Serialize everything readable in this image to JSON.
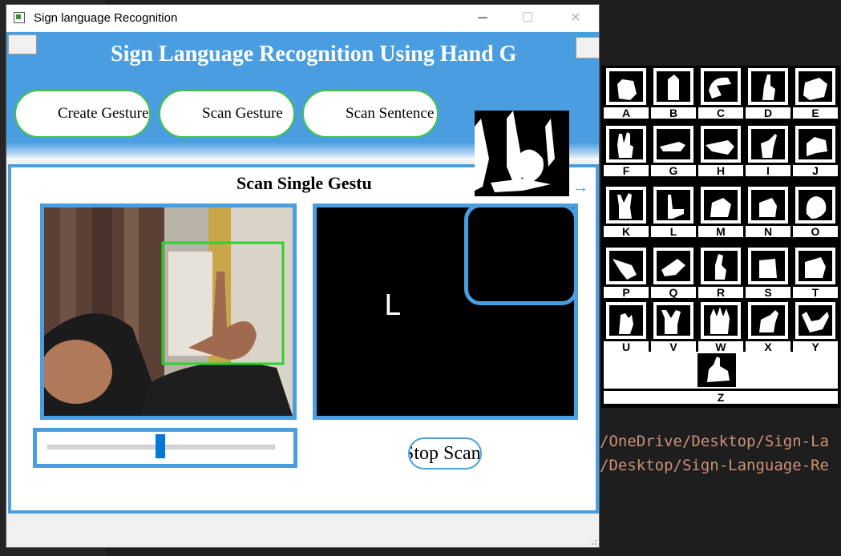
{
  "window": {
    "title": "Sign language Recognition",
    "controls": {
      "minimize": "─",
      "maximize": "☐",
      "close": "✕"
    }
  },
  "header": {
    "title": "Sign Language Recognition Using Hand G",
    "buttons": [
      {
        "label": "Create Gesture"
      },
      {
        "label": "Scan Gesture"
      },
      {
        "label": "Scan Sentence"
      }
    ]
  },
  "main": {
    "section_title": "Scan Single Gestu",
    "prediction": "L",
    "slider": {
      "value_fraction": 0.5
    },
    "stop_button": "Stop Scan"
  },
  "gesture_chart": {
    "letters": [
      "A",
      "B",
      "C",
      "D",
      "E",
      "F",
      "G",
      "H",
      "I",
      "J",
      "K",
      "L",
      "M",
      "N",
      "O",
      "P",
      "Q",
      "R",
      "S",
      "T",
      "U",
      "V",
      "W",
      "X",
      "Y"
    ],
    "last_letter": "Z"
  },
  "background": {
    "path_lines": [
      "/OneDrive/Desktop/Sign-La",
      "/Desktop/Sign-Language-Re"
    ]
  },
  "colors": {
    "accent": "#4a9ee0",
    "pill_border": "#3ec44d",
    "slider_thumb": "#0078d7",
    "box_green": "#2ad32a"
  }
}
